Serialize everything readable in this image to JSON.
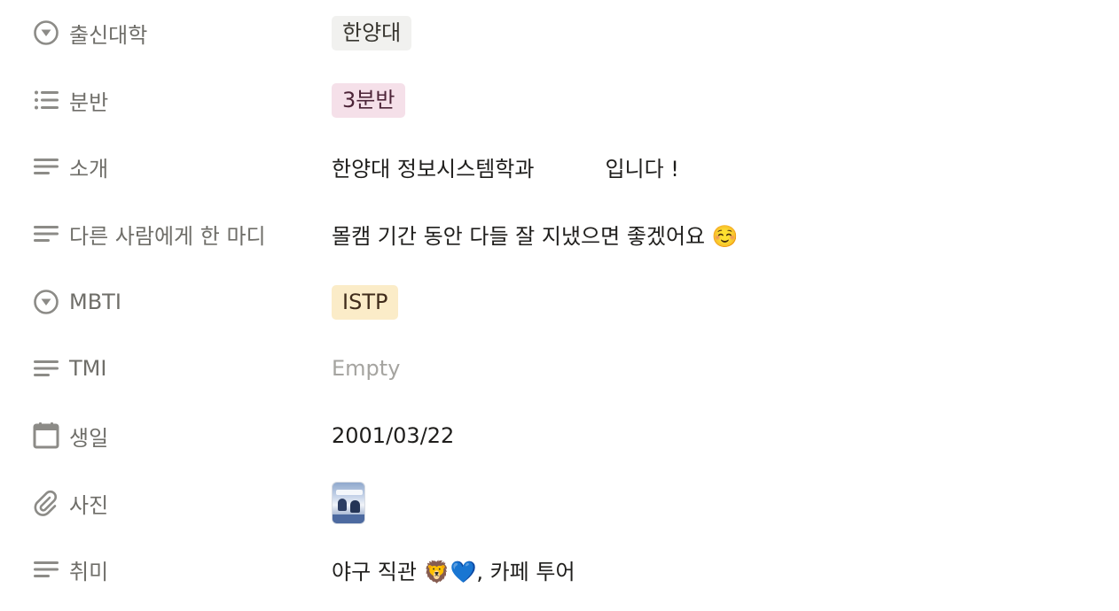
{
  "properties": [
    {
      "key": "university",
      "icon": "select-icon",
      "label": "출신대학",
      "tag": "한양대",
      "tag_color": "#f1f1ef"
    },
    {
      "key": "class",
      "icon": "multiselect-list-icon",
      "label": "분반",
      "tag": "3분반",
      "tag_color": "#f5e0e9"
    },
    {
      "key": "intro",
      "icon": "text-lines-icon",
      "label": "소개",
      "value_part1": "한양대 정보시스템학과",
      "value_part2": "입니다 !"
    },
    {
      "key": "message",
      "icon": "text-lines-icon",
      "label": "다른 사람에게 한 마디",
      "value": "몰캠 기간 동안 다들 잘 지냈으면 좋겠어요 ☺️"
    },
    {
      "key": "mbti",
      "icon": "select-icon",
      "label": "MBTI",
      "tag": "ISTP",
      "tag_color": "#fbecc8"
    },
    {
      "key": "tmi",
      "icon": "text-lines-icon",
      "label": "TMI",
      "value": "Empty"
    },
    {
      "key": "birthday",
      "icon": "calendar-icon",
      "label": "생일",
      "value": "2001/03/22"
    },
    {
      "key": "photo",
      "icon": "paperclip-icon",
      "label": "사진"
    },
    {
      "key": "hobby",
      "icon": "text-lines-icon",
      "label": "취미",
      "value": "야구 직관 🦁💙, 카페 투어"
    }
  ],
  "colors": {
    "icon": "#8c8b87",
    "label": "#6f6e69",
    "value": "#1f1e1c",
    "empty": "#a5a4a0"
  }
}
